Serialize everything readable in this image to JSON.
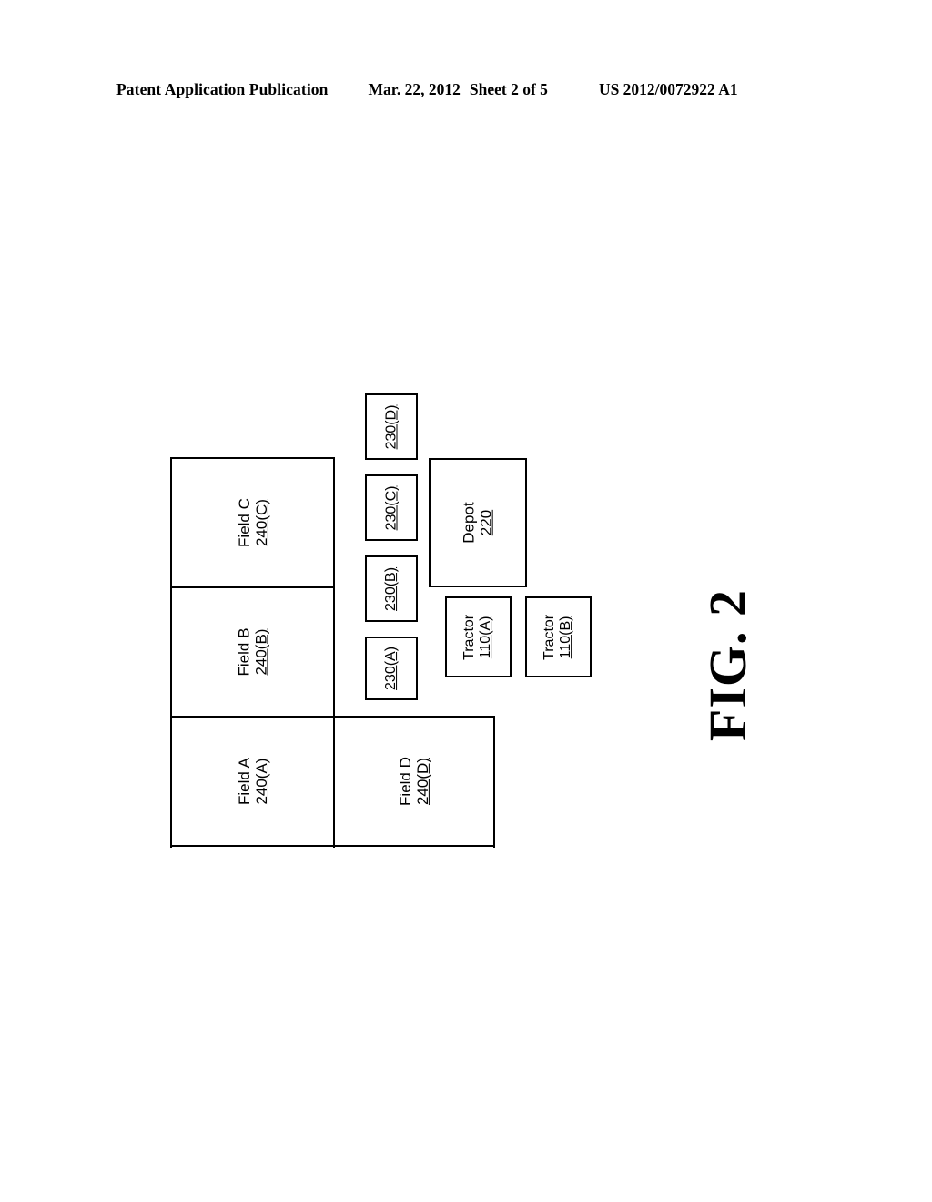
{
  "header": {
    "publication": "Patent Application Publication",
    "date": "Mar. 22, 2012",
    "sheet": "Sheet 2 of 5",
    "number": "US 2012/0072922 A1"
  },
  "figure": {
    "caption": "FIG. 2",
    "fields": [
      {
        "name": "Field C",
        "ref": "240(C)"
      },
      {
        "name": "Field B",
        "ref": "240(B)"
      },
      {
        "name": "Field A",
        "ref": "240(A)"
      },
      {
        "name": "Field D",
        "ref": "240(D)"
      }
    ],
    "tasks": [
      {
        "ref": "230(D)"
      },
      {
        "ref": "230(C)"
      },
      {
        "ref": "230(B)"
      },
      {
        "ref": "230(A)"
      }
    ],
    "depot": {
      "name": "Depot",
      "ref": "220"
    },
    "tractors": [
      {
        "name": "Tractor",
        "ref": "110(A)"
      },
      {
        "name": "Tractor",
        "ref": "110(B)"
      }
    ]
  },
  "colors": {
    "ink": "#000000",
    "paper": "#ffffff"
  }
}
